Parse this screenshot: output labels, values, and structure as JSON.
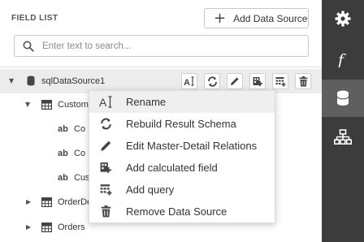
{
  "field_list": {
    "title": "FIELD LIST",
    "add_data_source_label": "Add Data Source",
    "search_placeholder": "Enter text to search...",
    "tree": {
      "root": "sqlDataSource1",
      "customers": "Customers",
      "fields": [
        "Co",
        "Co",
        "Cus"
      ],
      "order_details": "OrderDetails",
      "orders": "Orders"
    }
  },
  "context_menu": {
    "items": [
      {
        "label": "Rename",
        "icon": "rename-icon"
      },
      {
        "label": "Rebuild Result Schema",
        "icon": "rebuild-icon"
      },
      {
        "label": "Edit Master-Detail Relations",
        "icon": "pencil-icon"
      },
      {
        "label": "Add calculated field",
        "icon": "calculated-field-icon"
      },
      {
        "label": "Add query",
        "icon": "add-query-icon"
      },
      {
        "label": "Remove Data Source",
        "icon": "trash-icon"
      }
    ]
  },
  "sidebar": {
    "items": [
      "gear-icon",
      "function-icon",
      "database-icon",
      "hierarchy-icon"
    ],
    "active": "database-icon"
  },
  "colors": {
    "sidebar_bg": "#3c3c3c",
    "sidebar_active": "#5f5f5f",
    "selected_row": "#ececec"
  }
}
